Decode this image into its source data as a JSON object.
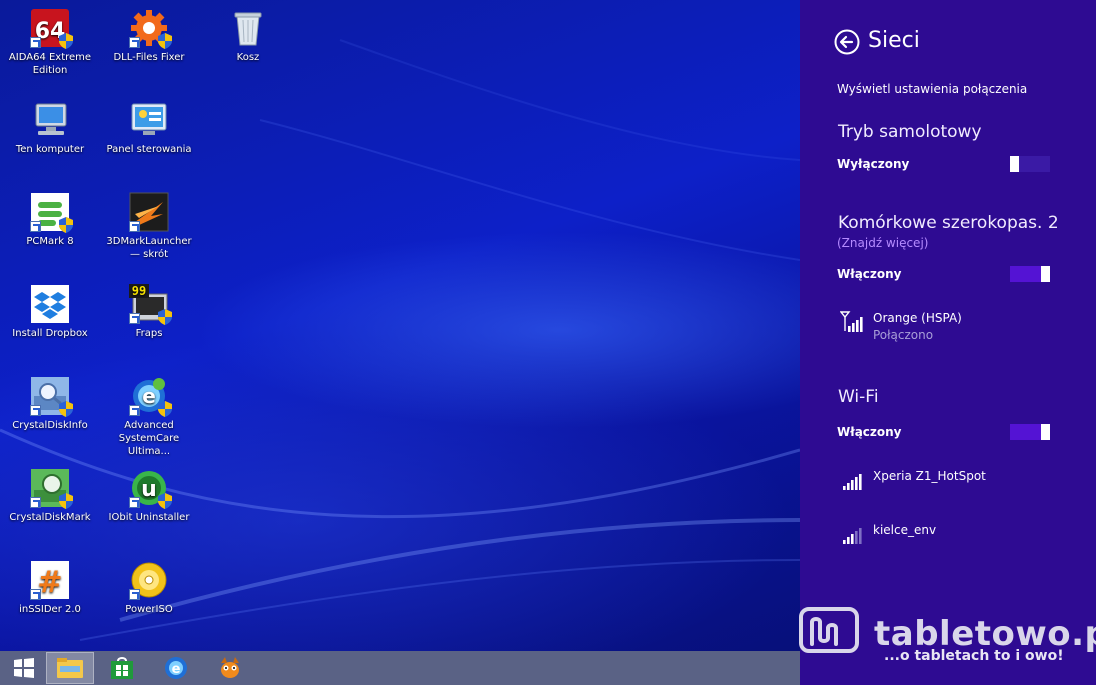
{
  "desktop": {
    "icons": [
      {
        "label": "AIDA64 Extreme Edition",
        "icon": "aida64-icon"
      },
      {
        "label": "DLL-Files Fixer",
        "icon": "gear-icon"
      },
      {
        "label": "Kosz",
        "icon": "recycle-bin-icon"
      },
      {
        "label": "Ten komputer",
        "icon": "computer-icon"
      },
      {
        "label": "Panel sterowania",
        "icon": "control-panel-icon"
      },
      {
        "label": "PCMark 8",
        "icon": "pcmark-icon"
      },
      {
        "label": "3DMarkLauncher — skrót",
        "icon": "3dmark-icon"
      },
      {
        "label": "Install Dropbox",
        "icon": "dropbox-icon"
      },
      {
        "label": "Fraps",
        "icon": "fraps-icon"
      },
      {
        "label": "CrystalDiskInfo",
        "icon": "crystaldiskinfo-icon"
      },
      {
        "label": "Advanced SystemCare Ultima...",
        "icon": "advanced-systemcare-icon"
      },
      {
        "label": "CrystalDiskMark",
        "icon": "crystaldiskmark-icon"
      },
      {
        "label": "IObit Uninstaller",
        "icon": "iobit-uninstaller-icon"
      },
      {
        "label": "inSSIDer 2.0",
        "icon": "inssider-icon"
      },
      {
        "label": "PowerISO",
        "icon": "poweriso-icon"
      }
    ],
    "aida_badge": "64",
    "fraps_badge": "99"
  },
  "taskbar": {
    "items": [
      "windows-start-icon",
      "file-explorer-icon",
      "store-icon",
      "advanced-systemcare-icon",
      "game-app-icon"
    ]
  },
  "panel": {
    "title": "Sieci",
    "view_settings": "Wyświetl ustawienia połączenia",
    "airplane": {
      "heading": "Tryb samolotowy",
      "state": "Wyłączony",
      "on": false
    },
    "mobile": {
      "heading": "Komórkowe szerokopas. 2",
      "find_more": "(Znajdź więcej)",
      "state": "Włączony",
      "on": true
    },
    "mobile_network": {
      "name": "Orange (HSPA)",
      "status": "Połączono"
    },
    "wifi": {
      "heading": "Wi-Fi",
      "state": "Włączony",
      "on": true
    },
    "wifi_networks": [
      {
        "name": "Xperia Z1_HotSpot",
        "bars": 5
      },
      {
        "name": "kielce_env",
        "bars": 3
      }
    ]
  },
  "watermark": {
    "brand": "tabletowo.pl",
    "tagline": "...o tabletach to i owo!"
  },
  "colors": {
    "panel_bg": "#2e0b92",
    "toggle_on": "#5413d4",
    "link": "#b58bff",
    "taskbar": "#5a6285",
    "desktop": "#0d20c8"
  }
}
